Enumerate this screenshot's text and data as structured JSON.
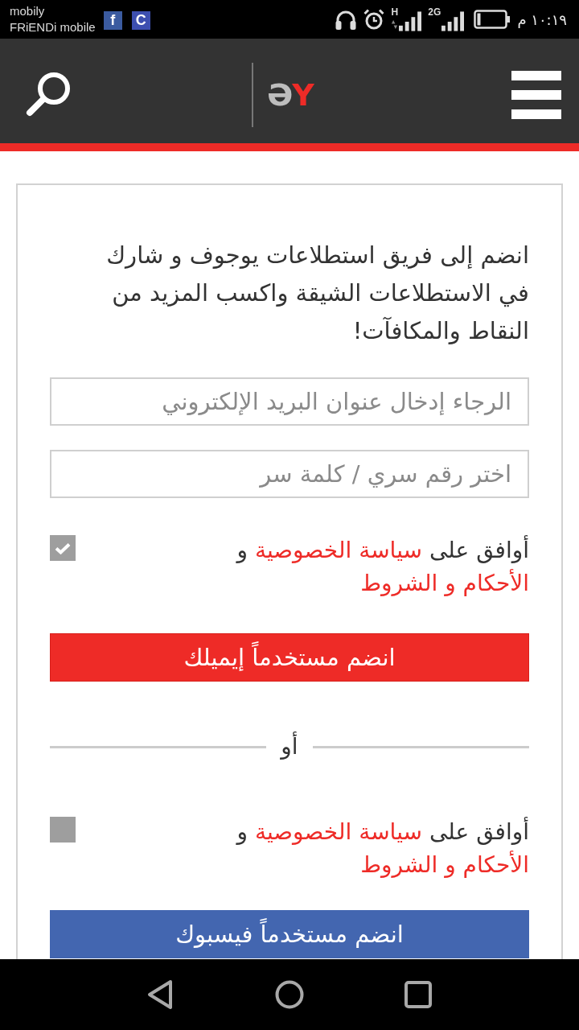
{
  "status_bar": {
    "carrier": [
      "mobily",
      "FRiENDi mobile"
    ],
    "notifications": [
      {
        "glyph": "C",
        "color": "#3d4fb0"
      },
      {
        "glyph": "f",
        "color": "#3b5ba0"
      }
    ],
    "networks": [
      {
        "label": "2G",
        "activity": false
      },
      {
        "label": "H",
        "activity": true
      }
    ],
    "time": "١٠:١٩ م"
  },
  "header": {
    "logo": "ƏY"
  },
  "signup": {
    "intro": "انضم إلى فريق استطلاعات يوجوف و شارك في الاستطلاعات الشيقة واكسب المزيد من النقاط والمكافآت!",
    "fields": [
      {
        "placeholder": "الرجاء إدخال عنوان البريد الإلكتروني"
      },
      {
        "placeholder": "اختر رقم سري / كلمة سر"
      }
    ],
    "email_consent": {
      "checked": true,
      "parts": [
        {
          "kind": "text",
          "text": "أوافق على"
        },
        {
          "kind": "link",
          "text": "سياسة الخصوصية"
        },
        {
          "kind": "text",
          "text": "و"
        },
        {
          "kind": "link",
          "text": "الأحكام و الشروط"
        }
      ]
    },
    "email_button": "انضم مستخدماً إيميلك",
    "separator": "أو",
    "facebook_consent": {
      "checked": false,
      "parts": [
        {
          "kind": "text",
          "text": "أوافق على"
        },
        {
          "kind": "link",
          "text": "سياسة الخصوصية"
        },
        {
          "kind": "text",
          "text": "و"
        },
        {
          "kind": "link",
          "text": "الأحكام و الشروط"
        }
      ]
    },
    "facebook_button": "انضم مستخدماً فيسبوك"
  }
}
